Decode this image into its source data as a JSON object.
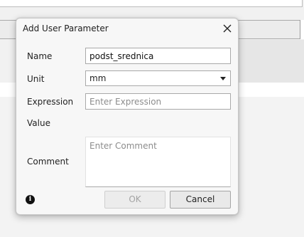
{
  "dialog": {
    "title": "Add User Parameter",
    "fields": {
      "name_label": "Name",
      "name_value": "podst_srednica",
      "unit_label": "Unit",
      "unit_value": "mm",
      "expression_label": "Expression",
      "expression_placeholder": "Enter Expression",
      "value_label": "Value",
      "comment_label": "Comment",
      "comment_placeholder": "Enter Comment"
    },
    "buttons": {
      "ok_label": "OK",
      "cancel_label": "Cancel"
    },
    "icons": {
      "close": "close-icon",
      "info": "info-icon",
      "dropdown": "chevron-down-icon"
    },
    "info_glyph": "i"
  },
  "colors": {
    "dialog_bg": "#f7f7f7",
    "disabled_text": "#a3a3a3",
    "placeholder_text": "#8c8c8c"
  }
}
